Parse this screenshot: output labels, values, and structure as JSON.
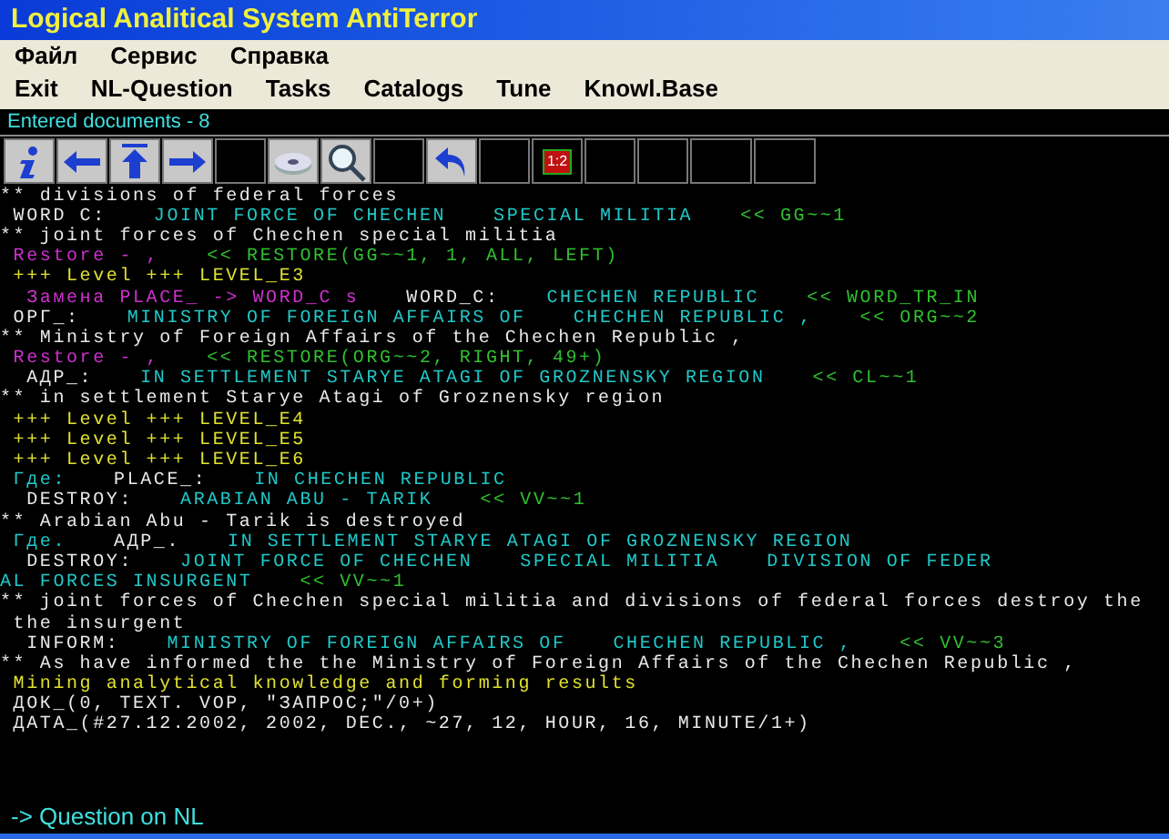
{
  "window": {
    "title": "Logical Analitical System AntiTerror"
  },
  "menu": [
    "Файл",
    "Сервис",
    "Справка"
  ],
  "menu2": [
    "Exit",
    "NL-Question",
    "Tasks",
    "Catalogs",
    "Tune",
    "Knowl.Base"
  ],
  "status": "Entered documents - 8",
  "toolbar": [
    {
      "kind": "info"
    },
    {
      "kind": "back"
    },
    {
      "kind": "up"
    },
    {
      "kind": "forward"
    },
    {
      "kind": "blank"
    },
    {
      "kind": "disk"
    },
    {
      "kind": "search"
    },
    {
      "kind": "blank"
    },
    {
      "kind": "undo"
    },
    {
      "kind": "blank"
    },
    {
      "kind": "ratio",
      "label": "1:2"
    },
    {
      "kind": "blank"
    },
    {
      "kind": "blank"
    },
    {
      "kind": "wide"
    },
    {
      "kind": "wide"
    }
  ],
  "log": [
    [
      {
        "kind": "note",
        "text": "** divisions of federal forces"
      }
    ],
    [
      {
        "kind": "label",
        "text": " WORD C:"
      },
      {
        "kind": "value",
        "text": "JOINT FORCE OF CHECHEN"
      },
      {
        "kind": "value",
        "text": "SPECIAL MILITIA"
      },
      {
        "kind": "ref",
        "text": "<< GG~~1"
      }
    ],
    [
      {
        "kind": "note",
        "text": "** joint forces of Chechen special militia"
      }
    ],
    [
      {
        "kind": "restore",
        "text": " Restore - ,"
      },
      {
        "kind": "ref",
        "text": "<< RESTORE(GG~~1, 1, ALL, LEFT)"
      }
    ],
    [
      {
        "kind": "level",
        "text": " +++ Level +++ LEVEL_E3"
      }
    ],
    [
      {
        "kind": "restore",
        "text": "  Замена PLACE_ -> WORD_C s"
      },
      {
        "kind": "label",
        "text": "WORD_C:"
      },
      {
        "kind": "value",
        "text": "CHECHEN REPUBLIC"
      },
      {
        "kind": "ref",
        "text": "<< WORD_TR_IN"
      }
    ],
    [
      {
        "kind": "label",
        "text": " ОРГ_:"
      },
      {
        "kind": "value",
        "text": "MINISTRY OF FOREIGN AFFAIRS OF"
      },
      {
        "kind": "value",
        "text": "CHECHEN REPUBLIC ,"
      },
      {
        "kind": "ref",
        "text": "<< ORG~~2"
      }
    ],
    [
      {
        "kind": "note",
        "text": "** Ministry of Foreign Affairs of the Chechen Republic ,"
      }
    ],
    [
      {
        "kind": "restore",
        "text": " Restore - ,"
      },
      {
        "kind": "ref",
        "text": "<< RESTORE(ORG~~2, RIGHT, 49+)"
      }
    ],
    [
      {
        "kind": "label",
        "text": "  АДР_:"
      },
      {
        "kind": "value",
        "text": "IN SETTLEMENT STARYE ATAGI OF GROZNENSKY REGION"
      },
      {
        "kind": "ref",
        "text": "<< CL~~1"
      }
    ],
    [
      {
        "kind": "note",
        "text": "** in settlement Starye Atagi of Groznensky region"
      }
    ],
    [
      {
        "kind": "level",
        "text": " +++ Level +++ LEVEL_E4"
      }
    ],
    [
      {
        "kind": "level",
        "text": " +++ Level +++ LEVEL_E5"
      }
    ],
    [
      {
        "kind": "level",
        "text": " +++ Level +++ LEVEL_E6"
      }
    ],
    [
      {
        "kind": "value",
        "text": " Где:"
      },
      {
        "kind": "label",
        "text": "PLACE_:"
      },
      {
        "kind": "value",
        "text": "IN CHECHEN REPUBLIC"
      }
    ],
    [
      {
        "kind": "label",
        "text": "  DESTROY:"
      },
      {
        "kind": "value",
        "text": "ARABIAN ABU - TARIK"
      },
      {
        "kind": "ref",
        "text": "<< VV~~1"
      }
    ],
    [
      {
        "kind": "note",
        "text": "** Arabian Abu - Tarik is destroyed"
      }
    ],
    [
      {
        "kind": "value",
        "text": " Где."
      },
      {
        "kind": "label",
        "text": "АДР_."
      },
      {
        "kind": "value",
        "text": "IN SETTLEMENT STARYE ATAGI OF GROZNENSKY REGION"
      }
    ],
    [
      {
        "kind": "label",
        "text": "  DESTROY:"
      },
      {
        "kind": "value",
        "text": "JOINT FORCE OF CHECHEN"
      },
      {
        "kind": "value",
        "text": "SPECIAL MILITIA"
      },
      {
        "kind": "value",
        "text": "DIVISION OF FEDER"
      }
    ],
    [
      {
        "kind": "value",
        "text": "AL FORCES INSURGENT"
      },
      {
        "kind": "ref",
        "text": "<< VV~~1"
      }
    ],
    [
      {
        "kind": "note",
        "text": "** joint forces of Chechen special militia and divisions of federal forces destroy the"
      }
    ],
    [
      {
        "kind": "note",
        "text": " the insurgent"
      }
    ],
    [
      {
        "kind": "label",
        "text": "  INFORM:"
      },
      {
        "kind": "value",
        "text": "MINISTRY OF FOREIGN AFFAIRS OF"
      },
      {
        "kind": "value",
        "text": "CHECHEN REPUBLIC ,"
      },
      {
        "kind": "ref",
        "text": "<< VV~~3"
      }
    ],
    [
      {
        "kind": "note",
        "text": "** As have informed the the Ministry of Foreign Affairs of the Chechen Republic ,"
      }
    ],
    [
      {
        "kind": "level",
        "text": " Mining analytical knowledge and forming results"
      }
    ],
    [
      {
        "kind": "label",
        "text": " ДОК_(0, TEXT. VOP, \"ЗАПРОС;\"/0+)"
      }
    ],
    [
      {
        "kind": "label",
        "text": " ДАТА_(#27.12.2002, 2002, DEC., ~27, 12, HOUR, 16, MINUTE/1+)"
      }
    ]
  ],
  "prompt": "-> Question on NL"
}
